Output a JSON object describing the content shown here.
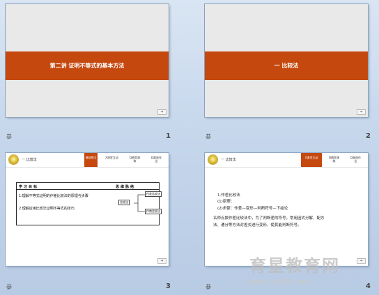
{
  "slides": [
    {
      "title": "第二讲  证明不等式的基本方法",
      "number": "1",
      "corner": "㳟"
    },
    {
      "title": "一  比较法",
      "number": "2",
      "corner": "㳟"
    },
    {
      "header": "一  比较法",
      "tabs": [
        "课前预习",
        "X课堂互动",
        "D随堂演练",
        "D高效作业"
      ],
      "goal_title": "学习目标",
      "mind_title": "思维脉络",
      "goals": [
        "1.理解不等式证明的作差比较法的原理与步骤",
        "2.理解应用比较法证明不等式的技巧"
      ],
      "mind_center": "比较法",
      "mind_nodes": [
        "作差比较法",
        "作商比较法"
      ],
      "number": "3",
      "corner": "㳟"
    },
    {
      "header": "一  比较法",
      "tabs": [
        "",
        "X课堂互动",
        "D随堂演练",
        "D高效作业"
      ],
      "lines": [
        "1.作差比较法",
        "(1)原理：",
        "(2)步骤：作差—变形—判断符号—下结论",
        "  名师点拨作差比较法中，为了判断差的符号，常用因式分解、配方",
        "法、通分等方法对差式进行变形，使其能判断符号。"
      ],
      "number": "4",
      "corner": "㳟"
    }
  ],
  "next_glyph": "➜",
  "watermark": "育星教育网",
  "watermark_url": "www.ht88.com"
}
